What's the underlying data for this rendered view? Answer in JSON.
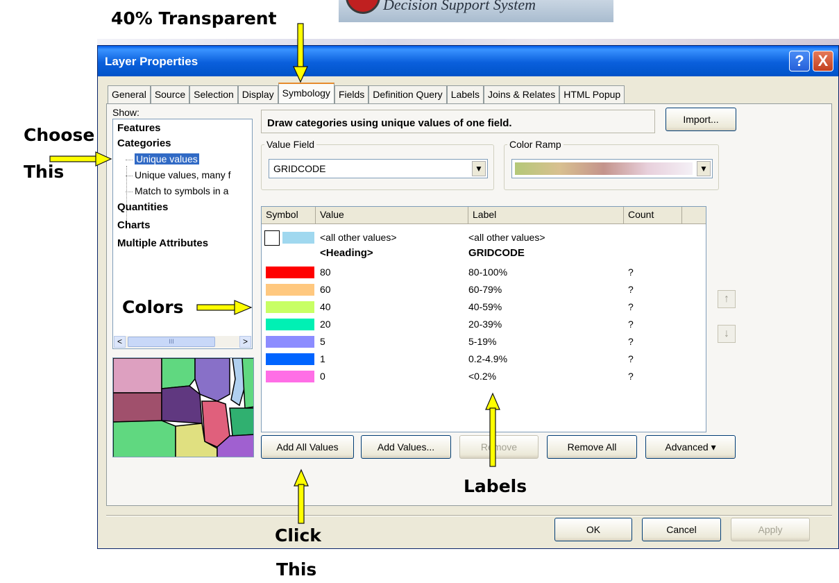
{
  "annotations": {
    "transparent": "40% Transparent",
    "choose": "Choose",
    "this1": "This",
    "colors": "Colors",
    "labels": "Labels",
    "click": "Click",
    "this2": "This"
  },
  "banner": {
    "text": "Decision Support System"
  },
  "dialog": {
    "title": "Layer Properties",
    "help": "?",
    "close": "X"
  },
  "tabs": [
    "General",
    "Source",
    "Selection",
    "Display",
    "Symbology",
    "Fields",
    "Definition Query",
    "Labels",
    "Joins & Relates",
    "HTML Popup"
  ],
  "active_tab": "Symbology",
  "show": {
    "label": "Show:",
    "features": "Features",
    "categories": "Categories",
    "unique_values": "Unique values",
    "unique_values_many": "Unique values, many f",
    "match_symbols": "Match to symbols in a",
    "quantities": "Quantities",
    "charts": "Charts",
    "multiple": "Multiple Attributes",
    "scroll_left": "<",
    "scroll_right": ">",
    "scroll_thumb": "III"
  },
  "description": "Draw categories using unique values of one field.",
  "import_label": "Import...",
  "value_field": {
    "label": "Value Field",
    "value": "GRIDCODE"
  },
  "color_ramp": {
    "label": "Color Ramp",
    "colors": [
      "#b4c878",
      "#d8c090",
      "#c4948c",
      "#e8d0dc",
      "#f4f0f6"
    ]
  },
  "table": {
    "headers": [
      "Symbol",
      "Value",
      "Label",
      "Count"
    ],
    "other": {
      "value": "<all other values>",
      "label": "<all other values>",
      "color": "#a0d8ef"
    },
    "heading": {
      "value": "<Heading>",
      "label": "GRIDCODE"
    },
    "rows": [
      {
        "value": "80",
        "label": "80-100%",
        "count": "?",
        "color": "#ff0000"
      },
      {
        "value": "60",
        "label": "60-79%",
        "count": "?",
        "color": "#ffc87f"
      },
      {
        "value": "40",
        "label": "40-59%",
        "count": "?",
        "color": "#c8ff64"
      },
      {
        "value": "20",
        "label": "20-39%",
        "count": "?",
        "color": "#00f0b4"
      },
      {
        "value": "5",
        "label": "5-19%",
        "count": "?",
        "color": "#8c8cff"
      },
      {
        "value": "1",
        "label": "0.2-4.9%",
        "count": "?",
        "color": "#0064ff"
      },
      {
        "value": "0",
        "label": "<0.2%",
        "count": "?",
        "color": "#ff6ee6"
      }
    ]
  },
  "buttons": {
    "add_all": "Add All Values",
    "add_values": "Add Values...",
    "remove": "Remove",
    "remove_all": "Remove All",
    "advanced": "Advanced",
    "ok": "OK",
    "cancel": "Cancel",
    "apply": "Apply",
    "move_up": "↑",
    "move_down": "↓"
  }
}
